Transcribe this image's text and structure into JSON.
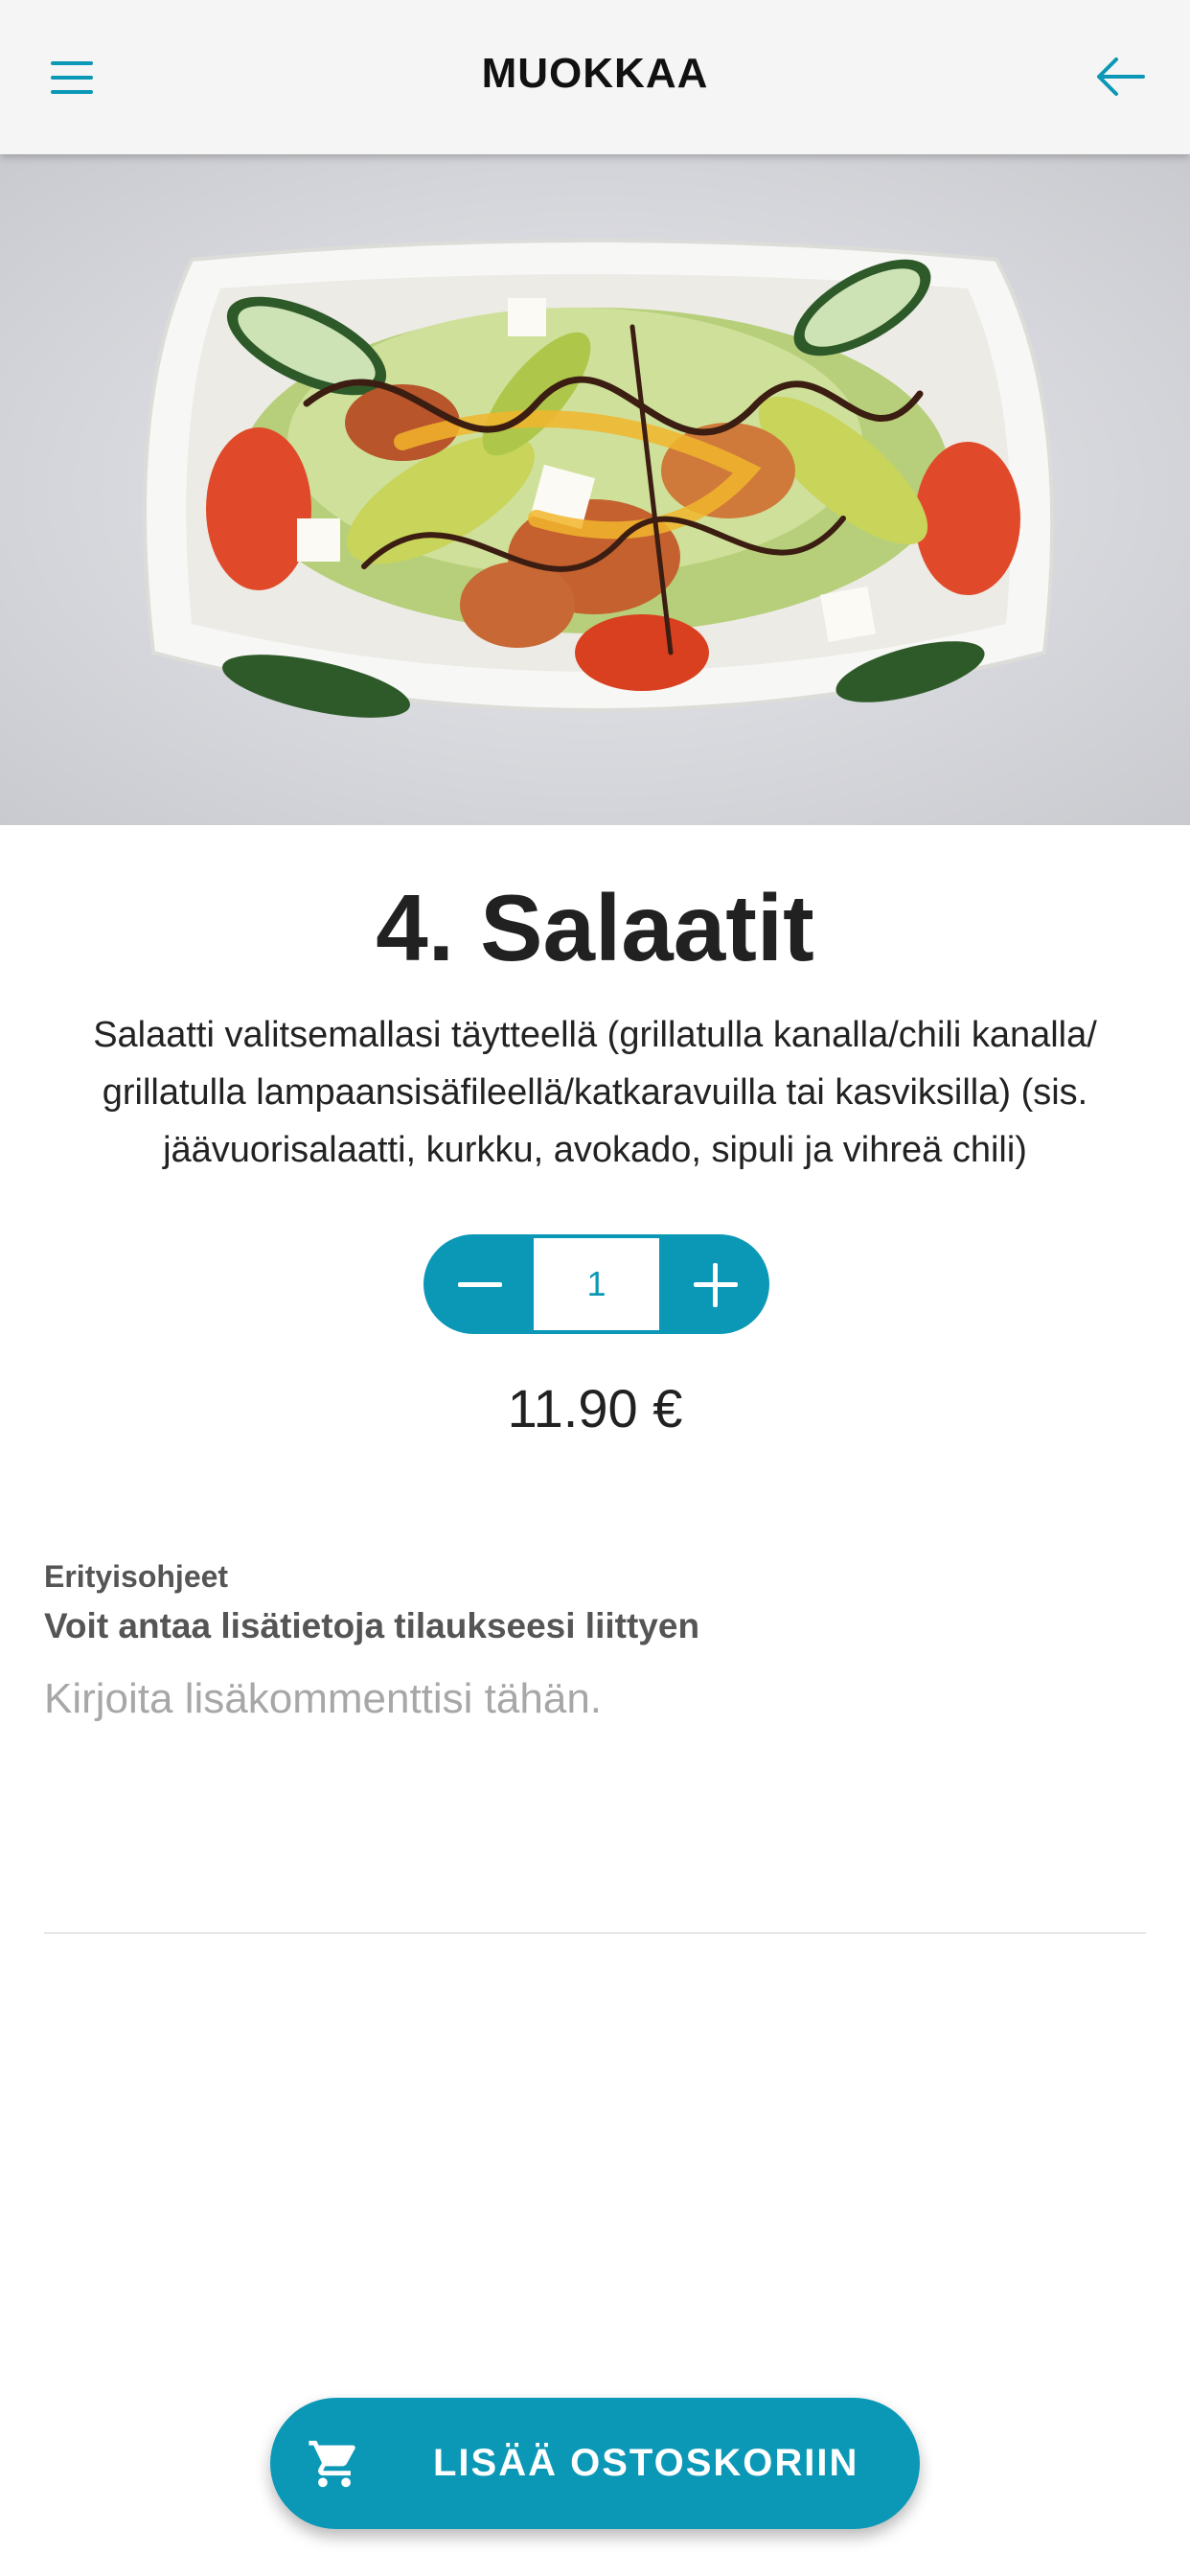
{
  "app_bar": {
    "title": "MUOKKAA",
    "menu_icon": "hamburger-menu-icon",
    "back_icon": "arrow-left-icon",
    "accent_color": "#0b98b6"
  },
  "product": {
    "image": "salad-photo",
    "title": "4. Salaatit",
    "description": "Salaatti valitsemallasi täytteellä (grillatulla kanalla/chili kanalla/ grillatulla lampaansisäfileellä/katkaravuilla tai kasviksilla) (sis. jäävuorisalaatti, kurkku, avokado, sipuli ja vihreä chili)",
    "quantity": "1",
    "price": "11.90 €"
  },
  "instructions": {
    "label": "Erityisohjeet",
    "subtitle": "Voit antaa lisätietoja tilaukseesi liittyen",
    "placeholder": "Kirjoita lisäkommenttisi tähän.",
    "value": ""
  },
  "cart_button": {
    "label": "LISÄÄ OSTOSKORIIN",
    "icon": "shopping-cart-icon"
  }
}
